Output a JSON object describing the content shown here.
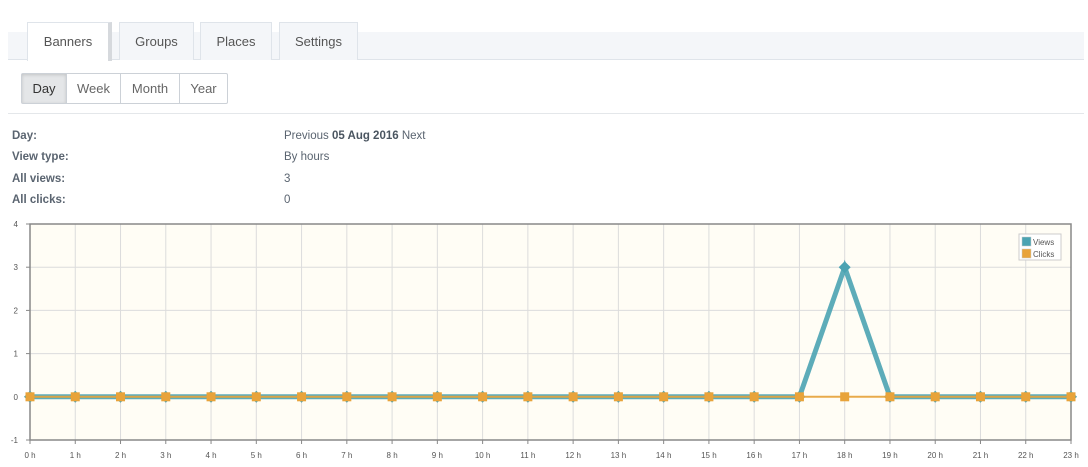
{
  "tabs": [
    {
      "label": "Banners",
      "active": true
    },
    {
      "label": "Groups",
      "active": false
    },
    {
      "label": "Places",
      "active": false
    },
    {
      "label": "Settings",
      "active": false
    }
  ],
  "periods": [
    {
      "label": "Day",
      "active": true
    },
    {
      "label": "Week",
      "active": false
    },
    {
      "label": "Month",
      "active": false
    },
    {
      "label": "Year",
      "active": false
    }
  ],
  "info": {
    "day_label": "Day:",
    "prev_label": "Previous",
    "date": "05 Aug 2016",
    "next_label": "Next",
    "view_type_label": "View type:",
    "view_type_value": "By hours",
    "all_views_label": "All views:",
    "all_views_value": "3",
    "all_clicks_label": "All clicks:",
    "all_clicks_value": "0"
  },
  "chart_data": {
    "type": "line",
    "x": [
      "0 h",
      "1 h",
      "2 h",
      "3 h",
      "4 h",
      "5 h",
      "6 h",
      "7 h",
      "8 h",
      "9 h",
      "10 h",
      "11 h",
      "12 h",
      "13 h",
      "14 h",
      "15 h",
      "16 h",
      "17 h",
      "18 h",
      "19 h",
      "20 h",
      "21 h",
      "22 h",
      "23 h"
    ],
    "series": [
      {
        "name": "Views",
        "color": "#4ba3b2",
        "values": [
          0,
          0,
          0,
          0,
          0,
          0,
          0,
          0,
          0,
          0,
          0,
          0,
          0,
          0,
          0,
          0,
          0,
          0,
          3,
          0,
          0,
          0,
          0,
          0
        ]
      },
      {
        "name": "Clicks",
        "color": "#e8a33a",
        "values": [
          0,
          0,
          0,
          0,
          0,
          0,
          0,
          0,
          0,
          0,
          0,
          0,
          0,
          0,
          0,
          0,
          0,
          0,
          0,
          0,
          0,
          0,
          0,
          0
        ]
      }
    ],
    "ylim": [
      -1,
      4
    ],
    "yticks": [
      -1,
      0,
      1,
      2,
      3,
      4
    ],
    "grid": true,
    "legend": "top-right",
    "background": "#fffdf5"
  }
}
